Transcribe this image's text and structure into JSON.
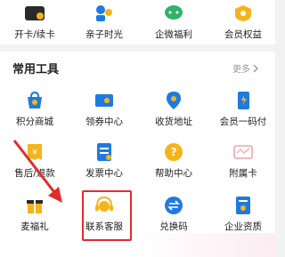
{
  "top_row": {
    "items": [
      {
        "label": "开卡/续卡",
        "icon": "card-icon"
      },
      {
        "label": "亲子时光",
        "icon": "parent-child-icon"
      },
      {
        "label": "企微福利",
        "icon": "wechat-work-icon"
      },
      {
        "label": "会员权益",
        "icon": "member-benefit-icon"
      }
    ]
  },
  "tools": {
    "title": "常用工具",
    "more_label": "更多",
    "items": [
      {
        "label": "积分商城",
        "icon": "points-mall-icon"
      },
      {
        "label": "领券中心",
        "icon": "coupon-center-icon"
      },
      {
        "label": "收货地址",
        "icon": "location-icon"
      },
      {
        "label": "会员一码付",
        "icon": "member-pay-icon"
      },
      {
        "label": "售后/退款",
        "icon": "refund-icon"
      },
      {
        "label": "发票中心",
        "icon": "invoice-icon"
      },
      {
        "label": "帮助中心",
        "icon": "help-icon"
      },
      {
        "label": "附属卡",
        "icon": "sub-card-icon"
      },
      {
        "label": "麦福礼",
        "icon": "gift-icon"
      },
      {
        "label": "联系客服",
        "icon": "customer-service-icon"
      },
      {
        "label": "兑换码",
        "icon": "redeem-code-icon"
      },
      {
        "label": "企业资质",
        "icon": "enterprise-qualification-icon"
      }
    ]
  },
  "colors": {
    "accent_blue": "#1f7ae0",
    "yellow": "#f4b41a",
    "highlight_red": "#e02c2c"
  }
}
